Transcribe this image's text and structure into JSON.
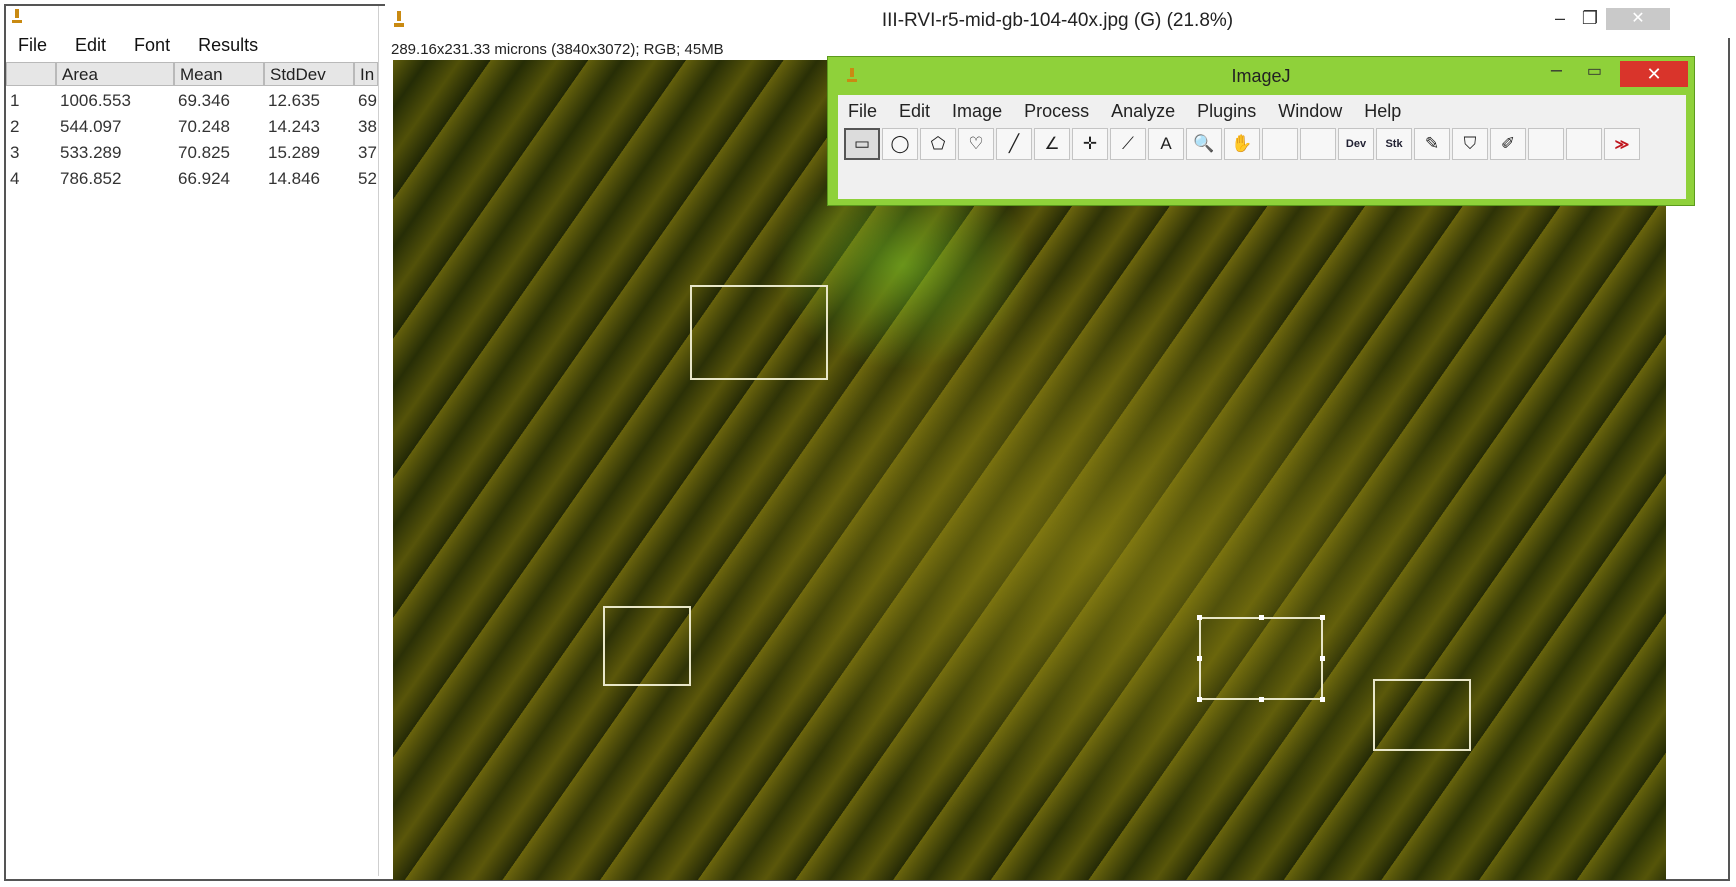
{
  "results": {
    "menu": [
      "File",
      "Edit",
      "Font",
      "Results"
    ],
    "columns": [
      "",
      "Area",
      "Mean",
      "StdDev",
      "In"
    ],
    "rows": [
      [
        "1",
        "1006.553",
        "69.346",
        "12.635",
        "69"
      ],
      [
        "2",
        "544.097",
        "70.248",
        "14.243",
        "38"
      ],
      [
        "3",
        "533.289",
        "70.825",
        "15.289",
        "37"
      ],
      [
        "4",
        "786.852",
        "66.924",
        "14.846",
        "52"
      ]
    ]
  },
  "image_window": {
    "title": "III-RVI-r5-mid-gb-104-40x.jpg (G) (21.8%)",
    "subtitle": "289.16x231.33 microns (3840x3072); RGB; 45MB",
    "minimize_glyph": "–",
    "restore_glyph": "❐",
    "close_glyph": "✕"
  },
  "imagej": {
    "title": "ImageJ",
    "menu": [
      "File",
      "Edit",
      "Image",
      "Process",
      "Analyze",
      "Plugins",
      "Window",
      "Help"
    ],
    "tools": [
      {
        "icon": "rectangle-tool-icon",
        "glyph": "▭",
        "selected": true
      },
      {
        "icon": "oval-tool-icon",
        "glyph": "◯"
      },
      {
        "icon": "polygon-tool-icon",
        "glyph": "⬠"
      },
      {
        "icon": "freehand-tool-icon",
        "glyph": "♡"
      },
      {
        "icon": "line-tool-icon",
        "glyph": "╱"
      },
      {
        "icon": "angle-tool-icon",
        "glyph": "∠"
      },
      {
        "icon": "point-tool-icon",
        "glyph": "✛"
      },
      {
        "icon": "wand-tool-icon",
        "glyph": "⟋"
      },
      {
        "icon": "text-tool-icon",
        "glyph": "A"
      },
      {
        "icon": "magnifier-tool-icon",
        "glyph": "🔍"
      },
      {
        "icon": "hand-tool-icon",
        "glyph": "✋"
      },
      {
        "icon": "color-picker-tool-icon",
        "glyph": ""
      },
      {
        "icon": "blank-tool-icon",
        "glyph": ""
      },
      {
        "icon": "dev-tool-icon",
        "glyph": "Dev"
      },
      {
        "icon": "stk-tool-icon",
        "glyph": "Stk"
      },
      {
        "icon": "brush-tool-icon",
        "glyph": "✎"
      },
      {
        "icon": "flood-fill-tool-icon",
        "glyph": "⛉"
      },
      {
        "icon": "pencil-tool-icon",
        "glyph": "✐"
      },
      {
        "icon": "blank-tool-icon",
        "glyph": ""
      },
      {
        "icon": "blank-tool-icon",
        "glyph": ""
      },
      {
        "icon": "more-tools-icon",
        "glyph": "≫"
      }
    ],
    "minimize_glyph": "–",
    "maximize_glyph": "▭",
    "close_glyph": "✕"
  },
  "colors": {
    "imagej_frame": "#8fd13a",
    "imagej_close": "#d9342b",
    "roi_stroke": "#e8e6c8"
  }
}
